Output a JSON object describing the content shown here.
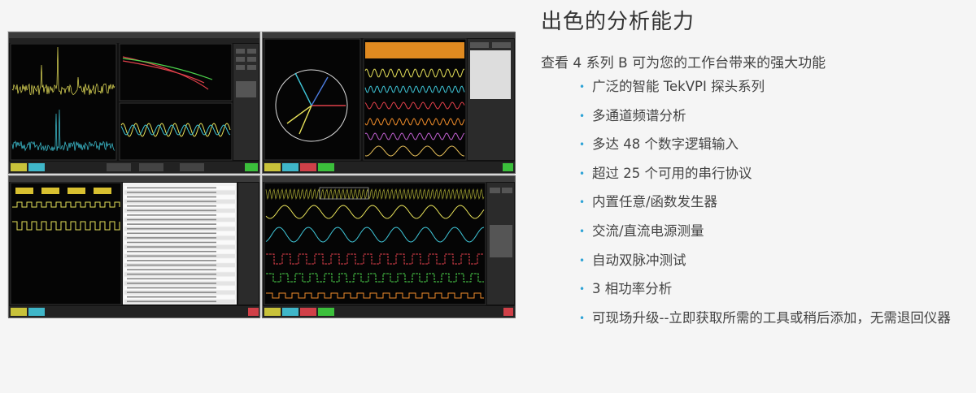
{
  "heading": "出色的分析能力",
  "intro": "查看 4 系列 B 可为您的工作台带来的强大功能",
  "features": [
    "广泛的智能 TekVPI 探头系列",
    "多通道频谱分析",
    "多达 48 个数字逻辑输入",
    "超过 25 个可用的串行协议",
    "内置任意/函数发生器",
    "交流/直流电源测量",
    "自动双脉冲测试",
    "3 相功率分析",
    "可现场升级--立即获取所需的工具或稍后添加，无需退回仪器"
  ],
  "colors": {
    "bullet": "#2ea3d6",
    "ch_yellow": "#e8e25a",
    "ch_cyan": "#3fc6d8",
    "ch_red": "#e0404a",
    "ch_green": "#4cd24c",
    "ch_orange": "#f08c2a",
    "ch_magenta": "#c060d0",
    "screen_bg": "#111111"
  },
  "screenshots": [
    {
      "name": "spectrum-analysis-screen"
    },
    {
      "name": "three-phase-power-screen"
    },
    {
      "name": "serial-decode-screen"
    },
    {
      "name": "multi-channel-waveform-screen"
    }
  ]
}
